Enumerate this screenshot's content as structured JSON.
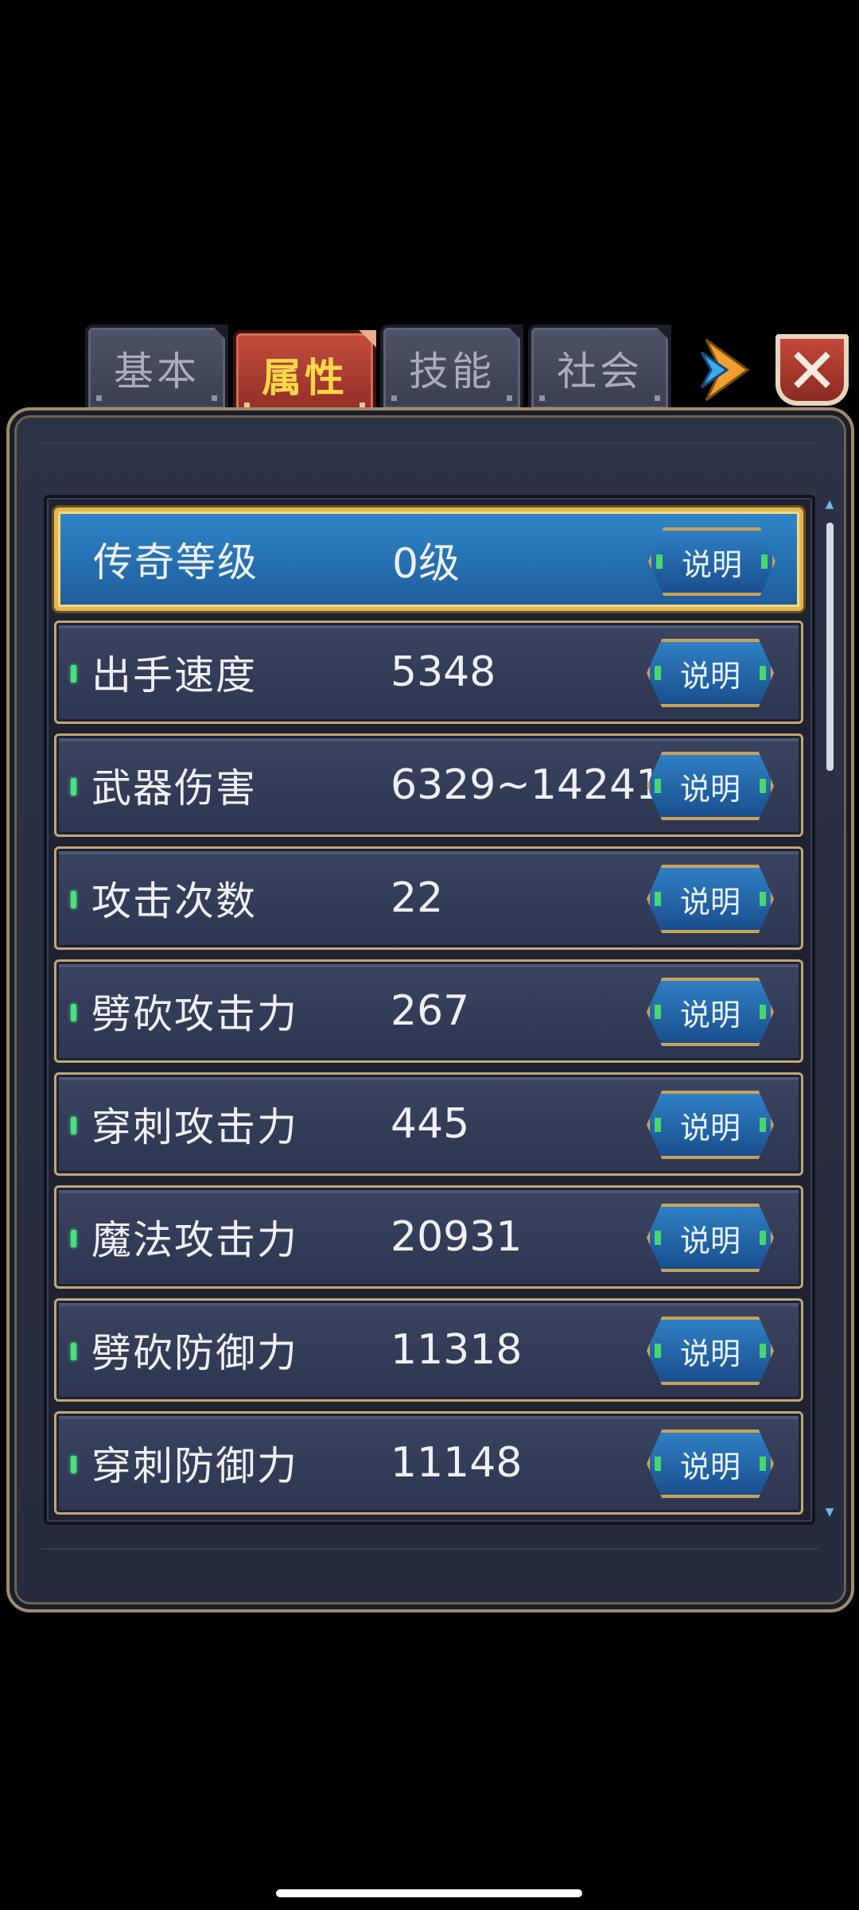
{
  "tabs": [
    {
      "label": "基本",
      "active": false
    },
    {
      "label": "属性",
      "active": true
    },
    {
      "label": "技能",
      "active": false
    },
    {
      "label": "社会",
      "active": false
    }
  ],
  "info_label": "说明",
  "attributes": [
    {
      "name": "传奇等级",
      "value": "0级",
      "highlighted": true
    },
    {
      "name": "出手速度",
      "value": "5348"
    },
    {
      "name": "武器伤害",
      "value": "6329~14241"
    },
    {
      "name": "攻击次数",
      "value": "22"
    },
    {
      "name": "劈砍攻击力",
      "value": "267"
    },
    {
      "name": "穿刺攻击力",
      "value": "445"
    },
    {
      "name": "魔法攻击力",
      "value": "20931"
    },
    {
      "name": "劈砍防御力",
      "value": "11318"
    },
    {
      "name": "穿刺防御力",
      "value": "11148"
    }
  ],
  "icons": {
    "next": "next-arrow-icon",
    "close": "close-icon"
  },
  "colors": {
    "accent": "#ffd84a",
    "active_tab": "#b8413a",
    "highlight_row": "#2f86c9",
    "indicator": "#49e07e"
  }
}
